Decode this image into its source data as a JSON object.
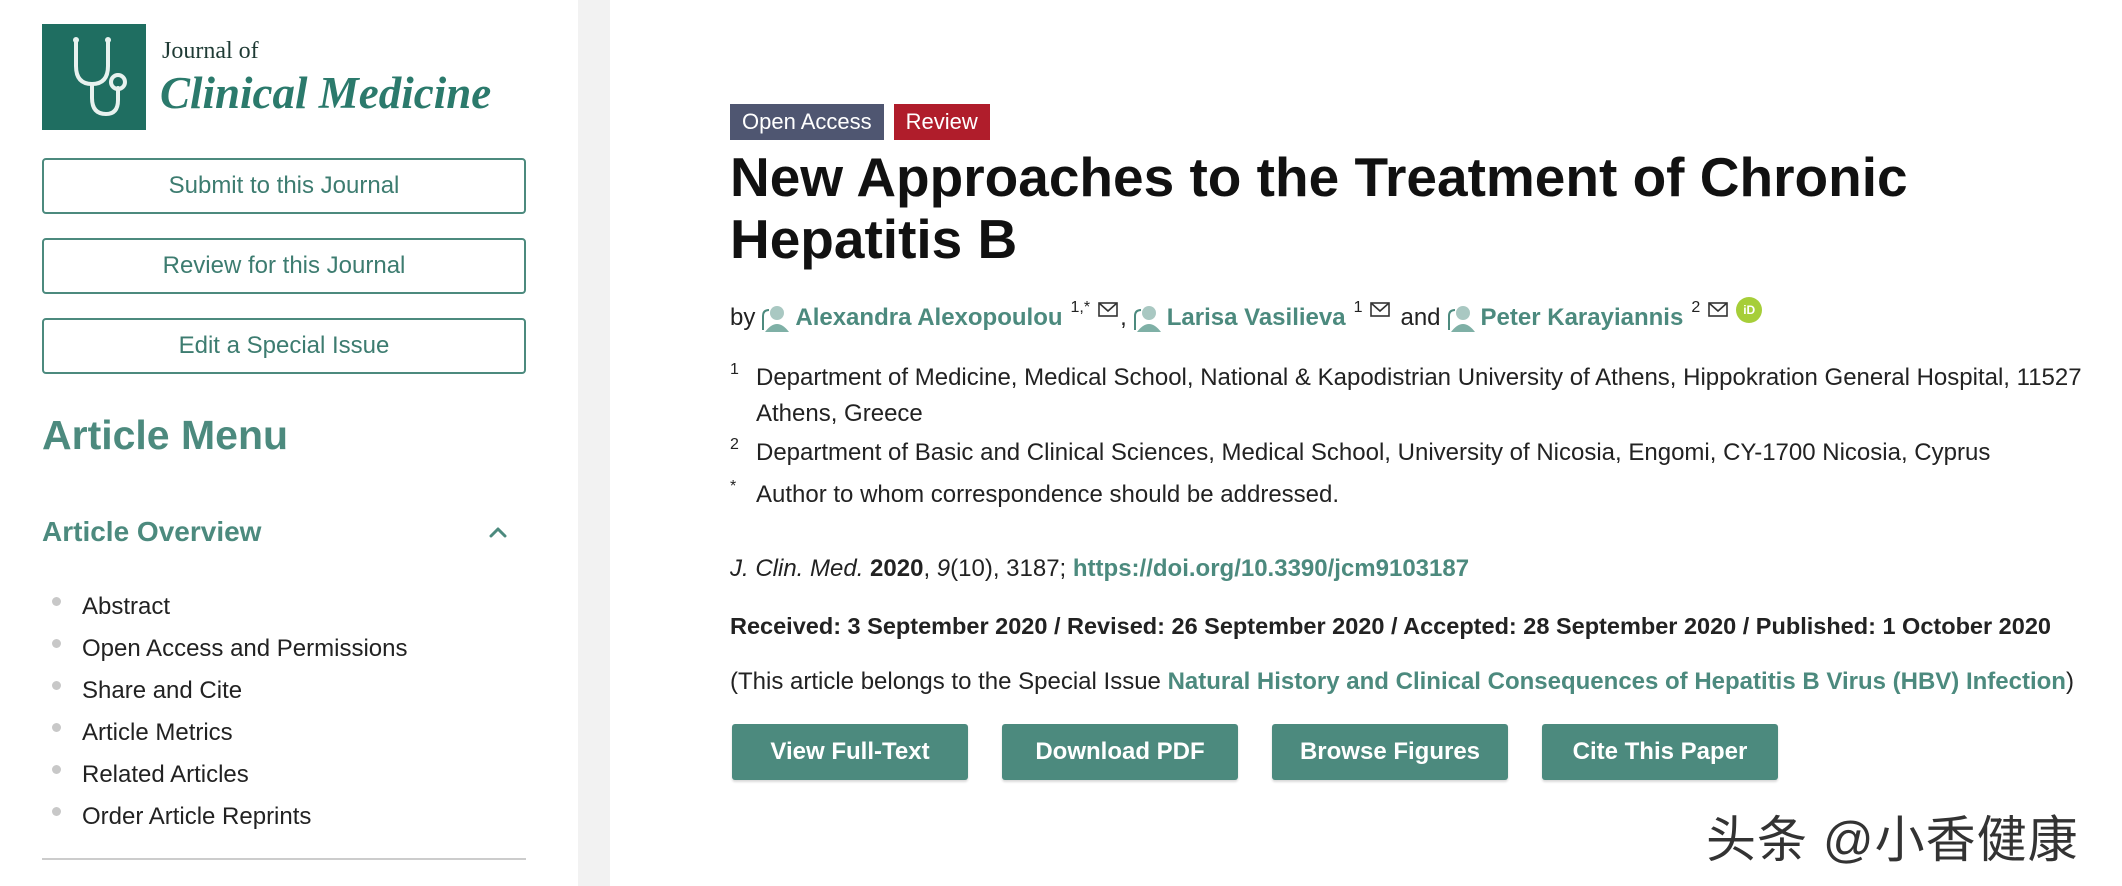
{
  "journal": {
    "name_line1": "Journal of",
    "name_line2": "Clinical Medicine",
    "brand_color": "#1f6e61"
  },
  "sidebar": {
    "buttons": [
      {
        "label": "Submit to this Journal"
      },
      {
        "label": "Review for this Journal"
      },
      {
        "label": "Edit a Special Issue"
      }
    ],
    "menu_title": "Article Menu",
    "overview_label": "Article Overview",
    "overview_items": [
      {
        "label": "Abstract"
      },
      {
        "label": "Open Access and Permissions"
      },
      {
        "label": "Share and Cite"
      },
      {
        "label": "Article Metrics"
      },
      {
        "label": "Related Articles"
      },
      {
        "label": "Order Article Reprints"
      }
    ]
  },
  "article": {
    "badges": {
      "open_access": "Open Access",
      "type": "Review"
    },
    "title": "New Approaches to the Treatment of Chronic Hepatitis B",
    "by": "by",
    "authors": [
      {
        "name": "Alexandra Alexopoulou",
        "sup": "1,*"
      },
      {
        "name": "Larisa Vasilieva",
        "sup": "1"
      },
      {
        "name": "Peter Karayiannis",
        "sup": "2"
      }
    ],
    "author_sep_comma": ",",
    "author_sep_and": "and",
    "orcid_label": "iD",
    "affiliations": [
      {
        "mark": "1",
        "text": "Department of Medicine, Medical School, National & Kapodistrian University of Athens, Hippokration General Hospital, 11527 Athens, Greece"
      },
      {
        "mark": "2",
        "text": "Department of Basic and Clinical Sciences, Medical School, University of Nicosia, Engomi, CY-1700 Nicosia, Cyprus"
      },
      {
        "mark": "*",
        "text": "Author to whom correspondence should be addressed."
      }
    ],
    "citation": {
      "journal_abbrev": "J. Clin. Med.",
      "year": "2020",
      "volume": "9",
      "issue_pages": "(10), 3187;",
      "doi": "https://doi.org/10.3390/jcm9103187"
    },
    "dates": "Received: 3 September 2020 / Revised: 26 September 2020 / Accepted: 28 September 2020 / Published: 1 October 2020",
    "special_issue": {
      "prefix": "(This article belongs to the Special Issue ",
      "link": "Natural History and Clinical Consequences of Hepatitis B Virus (HBV) Infection",
      "suffix": ")"
    },
    "actions": [
      {
        "label": "View Full-Text"
      },
      {
        "label": "Download PDF"
      },
      {
        "label": "Browse Figures"
      },
      {
        "label": "Cite This Paper"
      }
    ]
  },
  "watermark": "头条 @小香健康",
  "colors": {
    "accent": "#4c8a7e",
    "open_access": "#4f5671",
    "review": "#b01d2b",
    "orcid": "#a6ce39"
  }
}
